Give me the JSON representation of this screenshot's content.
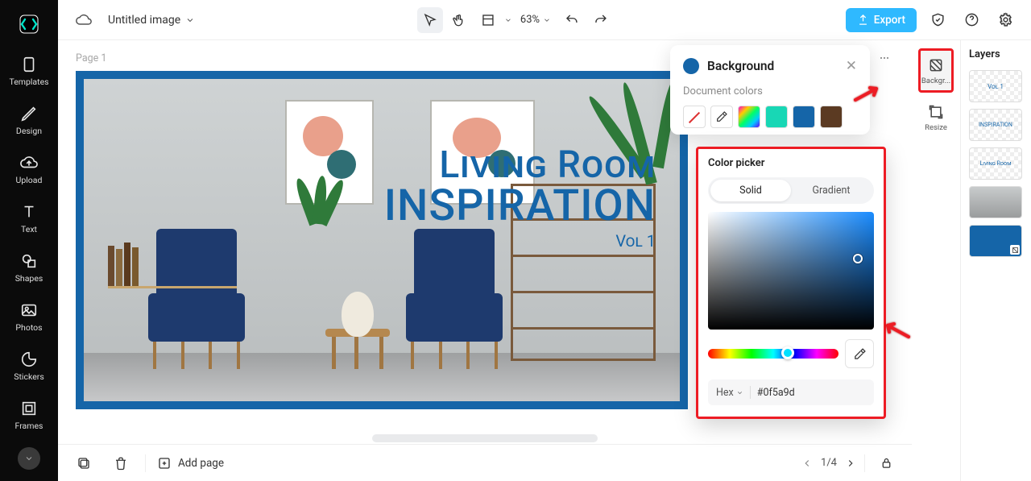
{
  "header": {
    "title": "Untitled image",
    "zoom": "63%",
    "export": "Export"
  },
  "left_sidebar": {
    "items": [
      "Templates",
      "Design",
      "Upload",
      "Text",
      "Shapes",
      "Photos",
      "Stickers",
      "Frames"
    ]
  },
  "canvas": {
    "page_label": "Page 1",
    "overlay": {
      "line1": "Living Room",
      "line2": "INSPIRATION",
      "line3": "Vol 1"
    }
  },
  "bg_panel": {
    "title": "Background",
    "section": "Document colors",
    "swatches": [
      "none",
      "eyedrop",
      "rainbow",
      "#18d7b5",
      "#1565a8",
      "#5b3a22"
    ]
  },
  "right_tools": {
    "background": "Backgr...",
    "resize": "Resize"
  },
  "picker": {
    "title": "Color picker",
    "tab_solid": "Solid",
    "tab_gradient": "Gradient",
    "hex_label": "Hex",
    "hex_value": "#0f5a9d"
  },
  "layers": {
    "title": "Layers",
    "thumbs": [
      "Vol 1",
      "INSPIRATION",
      "Living Room",
      "photo",
      "bg"
    ]
  },
  "footer": {
    "add_page": "Add page",
    "page_indicator": "1/4"
  }
}
